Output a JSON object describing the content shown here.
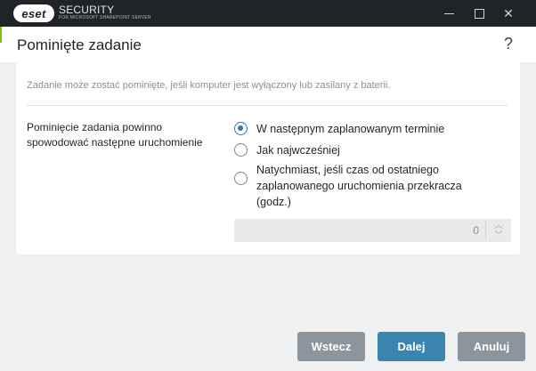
{
  "titlebar": {
    "logo_text": "eset",
    "product": "SECURITY",
    "product_sub": "FOR MICROSOFT SHAREPOINT SERVER"
  },
  "header": {
    "title": "Pominięte zadanie",
    "help": "?"
  },
  "panel": {
    "description": "Zadanie może zostać pominięte, jeśli komputer jest wyłączony lub zasilany z baterii.",
    "field_label": "Pominięcie zadania powinno spowodować następne uruchomienie",
    "options": [
      {
        "label": "W następnym zaplanowanym terminie",
        "selected": true
      },
      {
        "label": "Jak najwcześniej",
        "selected": false
      },
      {
        "label": "Natychmiast, jeśli czas od ostatniego zaplanowanego uruchomienia przekracza (godz.)",
        "selected": false
      }
    ],
    "hours_value": "0"
  },
  "footer": {
    "back_label": "Wstecz",
    "next_label": "Dalej",
    "cancel_label": "Anuluj"
  },
  "colors": {
    "accent": "#7ec300",
    "primary_button": "#3a84ad",
    "secondary_button": "#8c959b",
    "titlebar": "#202428"
  },
  "icons": [
    "minimize-icon",
    "maximize-icon",
    "close-icon",
    "help-icon",
    "chevron-up-icon",
    "chevron-down-icon"
  ]
}
